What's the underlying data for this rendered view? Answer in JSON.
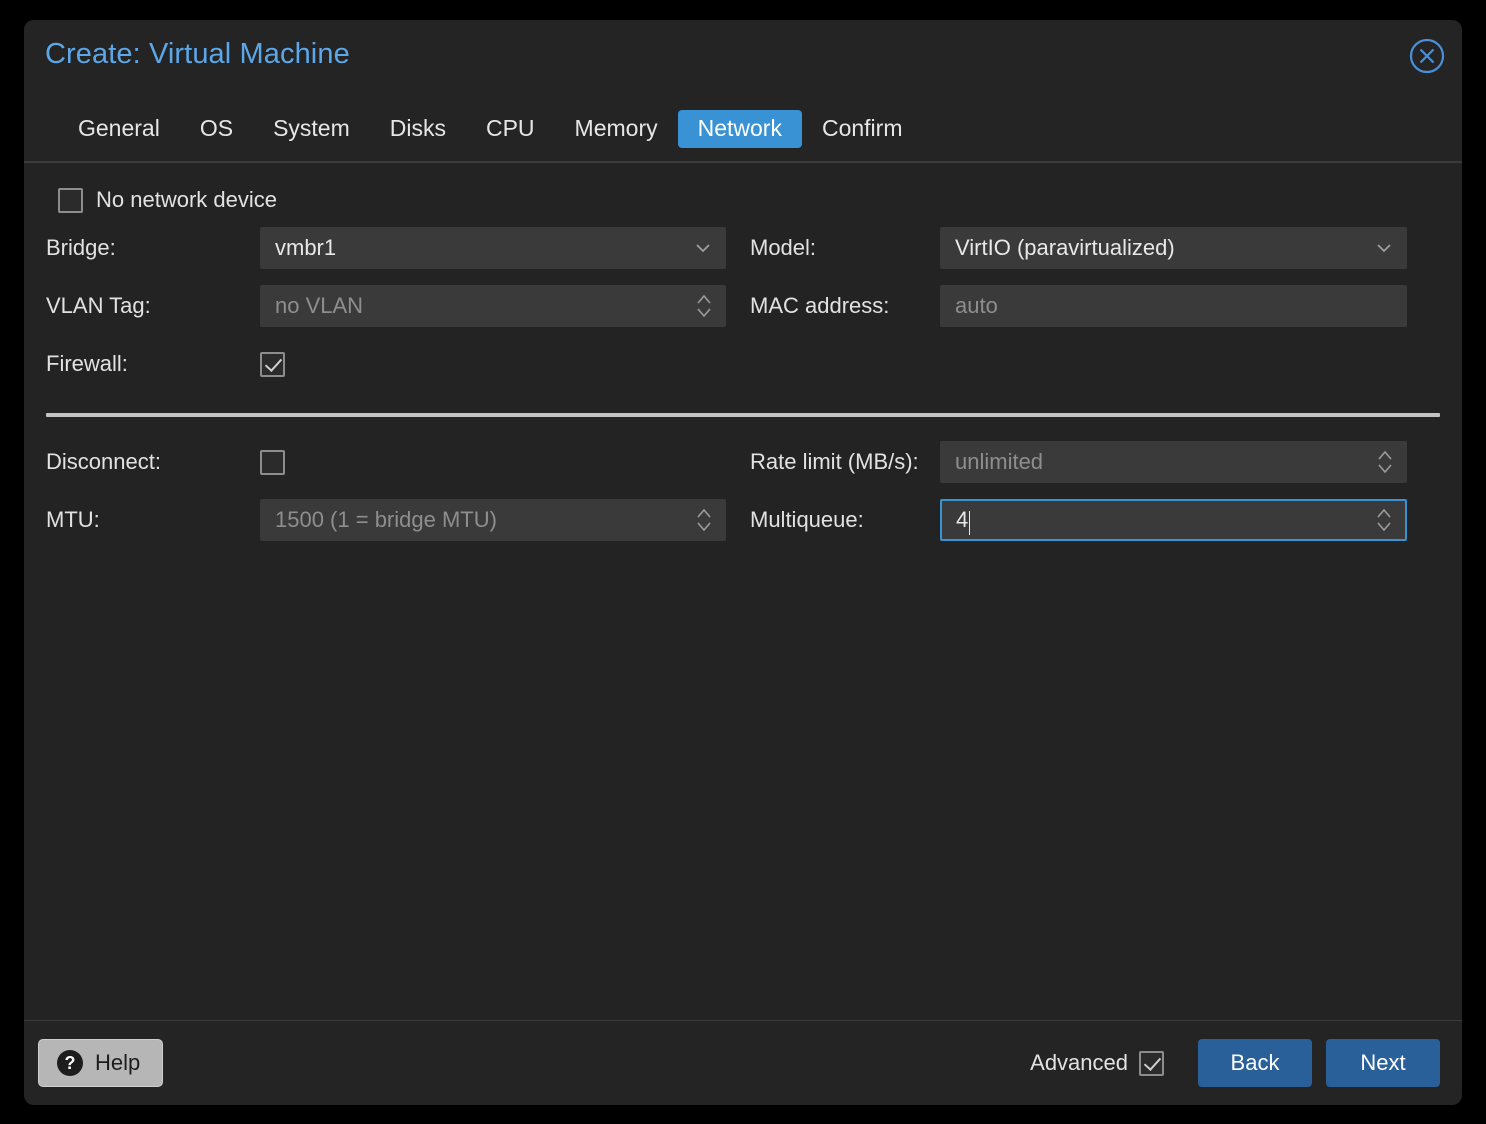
{
  "window": {
    "title": "Create: Virtual Machine",
    "close_icon": "close-circle-icon"
  },
  "tabs": [
    {
      "label": "General",
      "active": false
    },
    {
      "label": "OS",
      "active": false
    },
    {
      "label": "System",
      "active": false
    },
    {
      "label": "Disks",
      "active": false
    },
    {
      "label": "CPU",
      "active": false
    },
    {
      "label": "Memory",
      "active": false
    },
    {
      "label": "Network",
      "active": true
    },
    {
      "label": "Confirm",
      "active": false
    }
  ],
  "form": {
    "no_network_device": {
      "label": "No network device",
      "checked": false
    },
    "bridge": {
      "label": "Bridge:",
      "value": "vmbr1",
      "icon": "chevron-down-icon"
    },
    "model": {
      "label": "Model:",
      "value": "VirtIO (paravirtualized)",
      "icon": "chevron-down-icon"
    },
    "vlan_tag": {
      "label": "VLAN Tag:",
      "value": "",
      "placeholder": "no VLAN",
      "icon": "spinner-icon"
    },
    "mac_address": {
      "label": "MAC address:",
      "value": "",
      "placeholder": "auto"
    },
    "firewall": {
      "label": "Firewall:",
      "checked": true
    },
    "disconnect": {
      "label": "Disconnect:",
      "checked": false
    },
    "rate_limit": {
      "label": "Rate limit (MB/s):",
      "value": "",
      "placeholder": "unlimited",
      "icon": "spinner-icon"
    },
    "mtu": {
      "label": "MTU:",
      "value": "",
      "placeholder": "1500 (1 = bridge MTU)",
      "icon": "spinner-icon"
    },
    "multiqueue": {
      "label": "Multiqueue:",
      "value": "4",
      "placeholder": "",
      "icon": "spinner-icon",
      "focused": true
    }
  },
  "footer": {
    "help_label": "Help",
    "help_icon": "question-mark-icon",
    "advanced_label": "Advanced",
    "advanced_checked": true,
    "back_label": "Back",
    "next_label": "Next"
  },
  "colors": {
    "accent_blue": "#3892d4",
    "title_blue": "#5ba7e8",
    "button_blue": "#2a6099",
    "dialog_bg": "#242424",
    "field_bg": "#3a3a3a",
    "help_bg": "#b6b6b6"
  }
}
